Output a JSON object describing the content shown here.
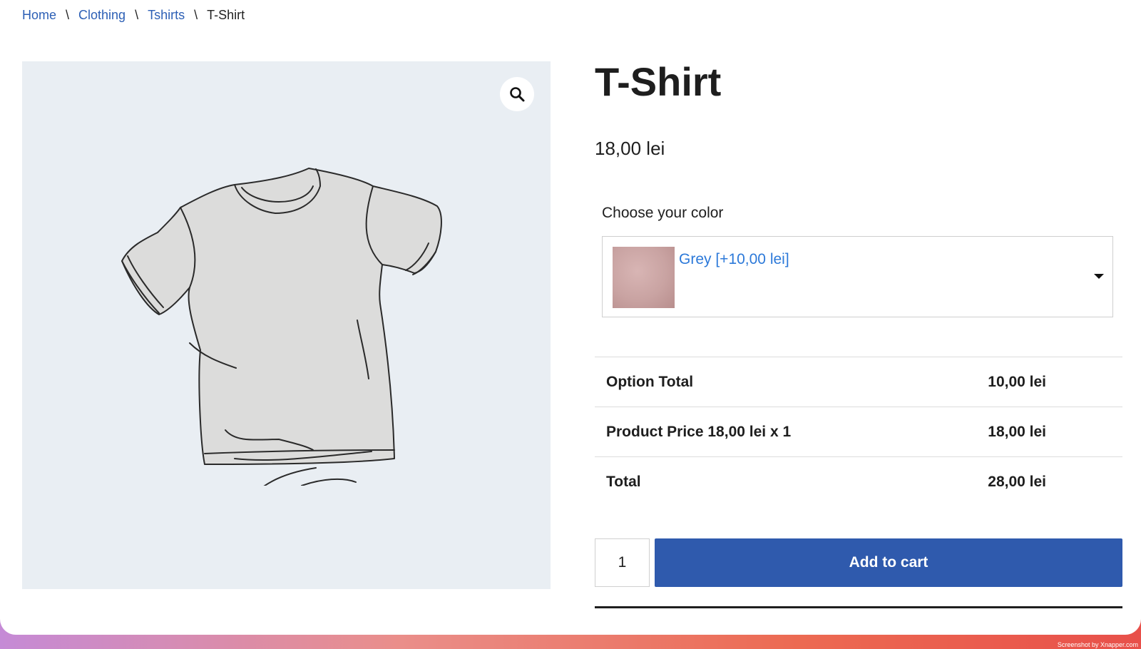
{
  "breadcrumb": {
    "home": "Home",
    "category": "Clothing",
    "subcategory": "Tshirts",
    "current": "T-Shirt",
    "separator": "\\"
  },
  "gallery": {
    "zoom_icon": "magnifier-icon",
    "image": "tshirt-sketch"
  },
  "product": {
    "title": "T-Shirt",
    "price": "18,00 lei"
  },
  "options": {
    "label": "Choose your color",
    "selected": "Grey [+10,00 lei]",
    "swatch_color": "#c9a3a2"
  },
  "totals": [
    {
      "label": "Option Total",
      "value": "10,00 lei"
    },
    {
      "label": "Product Price 18,00 lei x 1",
      "value": "18,00 lei"
    },
    {
      "label": "Total",
      "value": "28,00 lei"
    }
  ],
  "cart": {
    "quantity": "1",
    "add_label": "Add to cart",
    "button_color": "#2f5aad"
  },
  "footer": {
    "credit": "Screenshot by Xnapper.com"
  }
}
